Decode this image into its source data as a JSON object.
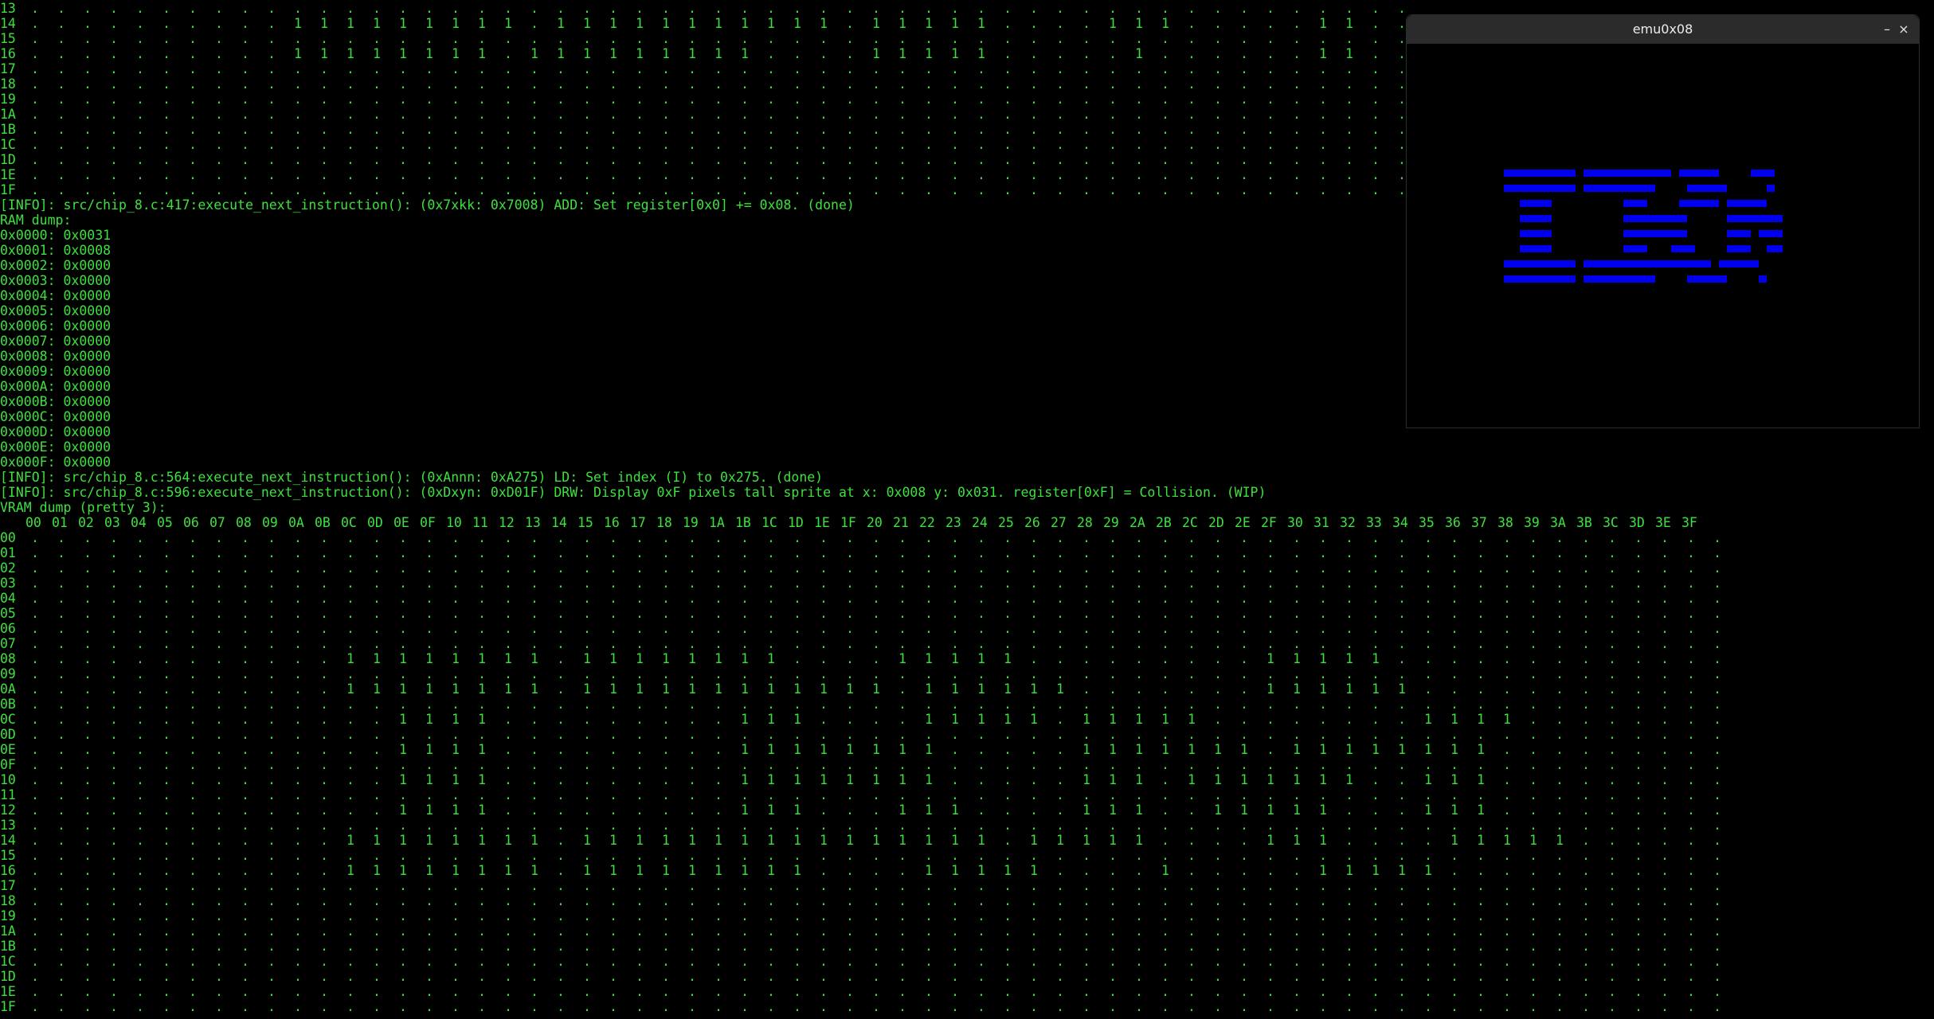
{
  "terminal": {
    "top_grid": {
      "row_labels": [
        "13",
        "14",
        "15",
        "16",
        "17",
        "18",
        "19",
        "1A",
        "1B",
        "1C",
        "1D",
        "1E",
        "1F"
      ],
      "rows": [
        "",
        "..........111111111.11111111111.11111....111.....11.",
        "",
        "..........11111111.111111111....11111.....1......11.",
        "",
        "",
        "",
        "",
        "",
        "",
        "",
        "",
        ""
      ]
    },
    "lines_middle": [
      "[INFO]: src/chip_8.c:417:execute_next_instruction(): (0x7xkk: 0x7008) ADD: Set register[0x0] += 0x08. (done)",
      "RAM dump:",
      "0x0000: 0x0031",
      "0x0001: 0x0008",
      "0x0002: 0x0000",
      "0x0003: 0x0000",
      "0x0004: 0x0000",
      "0x0005: 0x0000",
      "0x0006: 0x0000",
      "0x0007: 0x0000",
      "0x0008: 0x0000",
      "0x0009: 0x0000",
      "0x000A: 0x0000",
      "0x000B: 0x0000",
      "0x000C: 0x0000",
      "0x000D: 0x0000",
      "0x000E: 0x0000",
      "0x000F: 0x0000",
      "[INFO]: src/chip_8.c:564:execute_next_instruction(): (0xAnnn: 0xA275) LD: Set index (I) to 0x275. (done)",
      "[INFO]: src/chip_8.c:596:execute_next_instruction(): (0xDxyn: 0xD01F) DRW: Display 0xF pixels tall sprite at x: 0x008 y: 0x031. register[0xF] = Collision. (WIP)",
      "VRAM dump (pretty 3):"
    ],
    "vram_header": [
      "00",
      "01",
      "02",
      "03",
      "04",
      "05",
      "06",
      "07",
      "08",
      "09",
      "0A",
      "0B",
      "0C",
      "0D",
      "0E",
      "0F",
      "10",
      "11",
      "12",
      "13",
      "14",
      "15",
      "16",
      "17",
      "18",
      "19",
      "1A",
      "1B",
      "1C",
      "1D",
      "1E",
      "1F",
      "20",
      "21",
      "22",
      "23",
      "24",
      "25",
      "26",
      "27",
      "28",
      "29",
      "2A",
      "2B",
      "2C",
      "2D",
      "2E",
      "2F",
      "30",
      "31",
      "32",
      "33",
      "34",
      "35",
      "36",
      "37",
      "38",
      "39",
      "3A",
      "3B",
      "3C",
      "3D",
      "3E",
      "3F"
    ],
    "vram_grid": {
      "row_labels": [
        "00",
        "01",
        "02",
        "03",
        "04",
        "05",
        "06",
        "07",
        "08",
        "09",
        "0A",
        "0B",
        "0C",
        "0D",
        "0E",
        "0F",
        "10",
        "11",
        "12",
        "13",
        "14",
        "15",
        "16",
        "17",
        "18",
        "19",
        "1A",
        "1B",
        "1C",
        "1D",
        "1E",
        "1F"
      ],
      "rows": [
        "",
        "",
        "",
        "",
        "",
        "",
        "",
        "",
        "............11111111.11111111....11111.........11111",
        "",
        "............11111111.111111111111.111111.......111111",
        "",
        "..............1111.........111....11111.11111........1111",
        "",
        "..............1111.........11111111.....1111111.11111111",
        "",
        "..............1111.........11111111.....111.1111111..111",
        "",
        "..............1111.........111...111....111..11111...111",
        "",
        "............11111111.1111111111111111.11111....111....11111",
        "",
        "............11111111.111111111....11111....1.....11111",
        "",
        "",
        "",
        "",
        "",
        "",
        "",
        "",
        ""
      ]
    }
  },
  "emu_window": {
    "title": "emu0x08",
    "minimize_label": "–",
    "close_label": "×",
    "pixel_color": "#0000ee",
    "background_color": "#000000",
    "framebuffer_rows": [
      "111111111.11111111111.11111....111",
      "",
      "111111111.111111111....11111.....1",
      "",
      "..1111.........111....11111.11111",
      "",
      "..1111.........11111111.....1111111",
      "",
      "..1111.........11111111.....111.111",
      "",
      "..1111.........111...111....111..11",
      "",
      "111111111.1111111111111111.11111..",
      "",
      "111111111.111111111....11111....1."
    ]
  }
}
